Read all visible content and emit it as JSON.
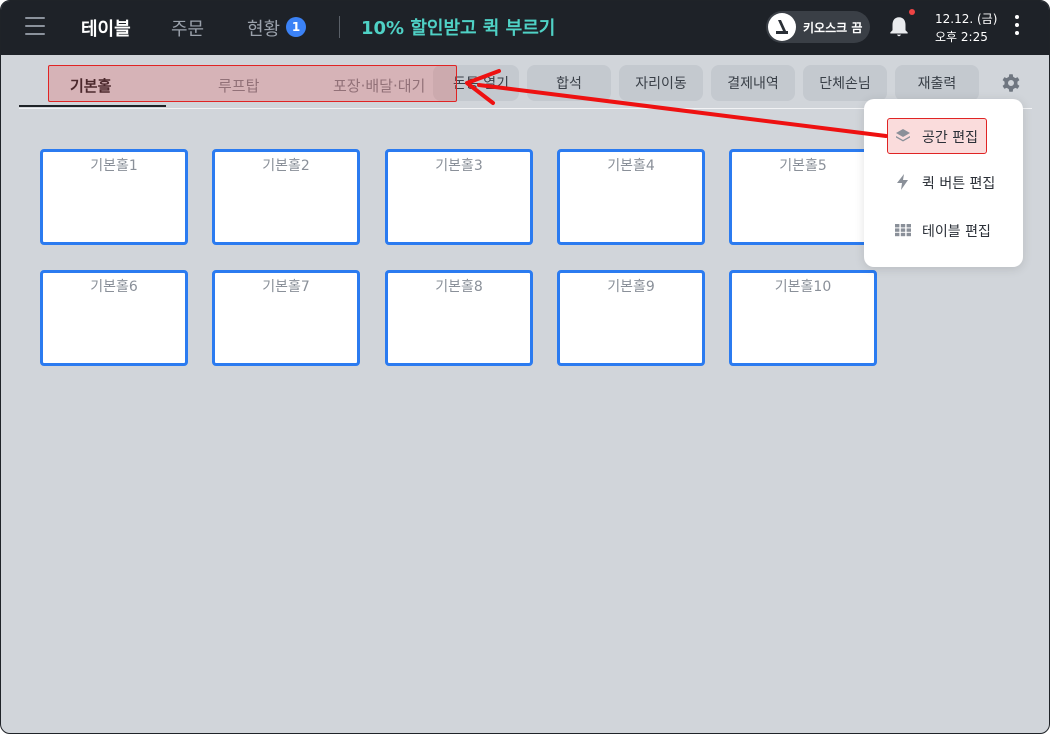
{
  "topbar": {
    "nav": {
      "table": "테이블",
      "order": "주문",
      "status": "현황",
      "status_badge": "1"
    },
    "promo": "10% 할인받고 퀵 부르기",
    "kiosk_toggle": "키오스크 끔",
    "date": "12.12. (금)",
    "time": "오후 2:25"
  },
  "space_tabs": [
    "기본홀",
    "루프탑",
    "포장·배달·대기"
  ],
  "toolbar_buttons": [
    "돈통 열기",
    "합석",
    "자리이동",
    "결제내역",
    "단체손님",
    "재출력"
  ],
  "tables": [
    "기본홀1",
    "기본홀2",
    "기본홀3",
    "기본홀4",
    "기본홀5",
    "기본홀6",
    "기본홀7",
    "기본홀8",
    "기본홀9",
    "기본홀10"
  ],
  "settings_menu": {
    "items": [
      "공간 편집",
      "퀵 버튼 편집",
      "테이블 편집"
    ]
  },
  "colors": {
    "topbar_bg": "#1e2228",
    "accent": "#2b7bf0",
    "promo": "#4fd1c5",
    "annotation": "#e02424"
  },
  "icons": {
    "menu": "hamburger-icon",
    "notifications": "bell-icon",
    "more": "kebab-icon",
    "settings": "gear-icon",
    "space_edit": "layers-icon",
    "quick_button_edit": "lightning-icon",
    "table_edit": "grid-icon"
  }
}
